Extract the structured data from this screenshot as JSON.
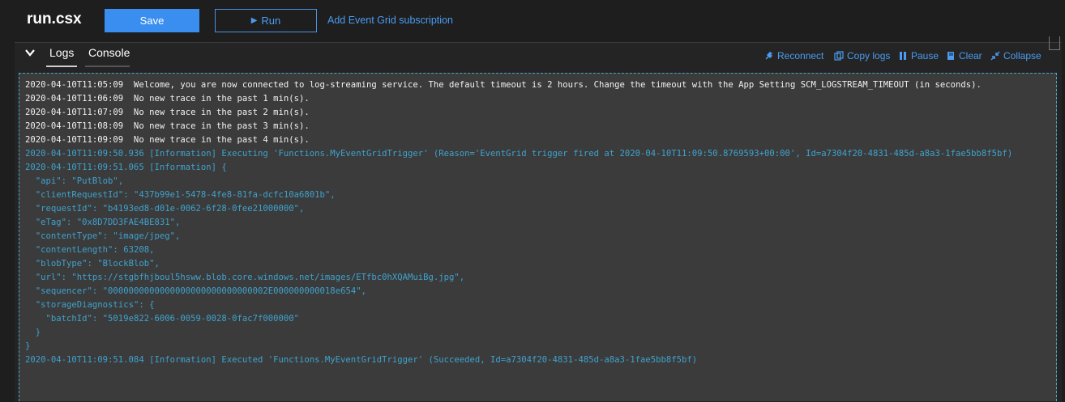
{
  "header": {
    "title": "run.csx",
    "save_label": "Save",
    "run_label": "Run",
    "subscription_link": "Add Event Grid subscription"
  },
  "logs_panel": {
    "tabs": [
      {
        "label": "Logs",
        "active": true
      },
      {
        "label": "Console",
        "active": false
      }
    ],
    "toolbar": {
      "reconnect": "Reconnect",
      "copy_logs": "Copy logs",
      "pause": "Pause",
      "clear": "Clear",
      "collapse": "Collapse"
    },
    "lines": [
      {
        "text": "2020-04-10T11:05:09  Welcome, you are now connected to log-streaming service. The default timeout is 2 hours. Change the timeout with the App Setting SCM_LOGSTREAM_TIMEOUT (in seconds).",
        "kind": "plain"
      },
      {
        "text": "2020-04-10T11:06:09  No new trace in the past 1 min(s).",
        "kind": "plain"
      },
      {
        "text": "2020-04-10T11:07:09  No new trace in the past 2 min(s).",
        "kind": "plain"
      },
      {
        "text": "2020-04-10T11:08:09  No new trace in the past 3 min(s).",
        "kind": "plain"
      },
      {
        "text": "2020-04-10T11:09:09  No new trace in the past 4 min(s).",
        "kind": "plain"
      },
      {
        "text": "2020-04-10T11:09:50.936 [Information] Executing 'Functions.MyEventGridTrigger' (Reason='EventGrid trigger fired at 2020-04-10T11:09:50.8769593+00:00', Id=a7304f20-4831-485d-a8a3-1fae5bb8f5bf)",
        "kind": "info"
      },
      {
        "text": "2020-04-10T11:09:51.065 [Information] {",
        "kind": "info"
      },
      {
        "text": "  \"api\": \"PutBlob\",",
        "kind": "info"
      },
      {
        "text": "  \"clientRequestId\": \"437b99e1-5478-4fe8-81fa-dcfc10a6801b\",",
        "kind": "info"
      },
      {
        "text": "  \"requestId\": \"b4193ed8-d01e-0062-6f28-0fee21000000\",",
        "kind": "info"
      },
      {
        "text": "  \"eTag\": \"0x8D7DD3FAE4BE831\",",
        "kind": "info"
      },
      {
        "text": "  \"contentType\": \"image/jpeg\",",
        "kind": "info"
      },
      {
        "text": "  \"contentLength\": 63208,",
        "kind": "info"
      },
      {
        "text": "  \"blobType\": \"BlockBlob\",",
        "kind": "info"
      },
      {
        "text": "  \"url\": \"https://stgbfhjboul5hsww.blob.core.windows.net/images/ETfbc0hXQAMuiBg.jpg\",",
        "kind": "info"
      },
      {
        "text": "  \"sequencer\": \"0000000000000000000000000000002E000000000018e654\",",
        "kind": "info"
      },
      {
        "text": "  \"storageDiagnostics\": {",
        "kind": "info"
      },
      {
        "text": "    \"batchId\": \"5019e822-6006-0059-0028-0fac7f000000\"",
        "kind": "info"
      },
      {
        "text": "  }",
        "kind": "info"
      },
      {
        "text": "}",
        "kind": "info"
      },
      {
        "text": "2020-04-10T11:09:51.084 [Information] Executed 'Functions.MyEventGridTrigger' (Succeeded, Id=a7304f20-4831-485d-a8a3-1fae5bb8f5bf)",
        "kind": "info"
      }
    ]
  },
  "colors": {
    "accent": "#3a8ef0",
    "link": "#4a9cf0",
    "info_text": "#3fa2ce",
    "plain_text": "#f2f2f2",
    "log_background": "#3b3b3b"
  },
  "icons": [
    "play-icon",
    "chevron-down-icon",
    "plug-icon",
    "copy-icon",
    "pause-icon",
    "book-icon",
    "collapse-icon"
  ]
}
